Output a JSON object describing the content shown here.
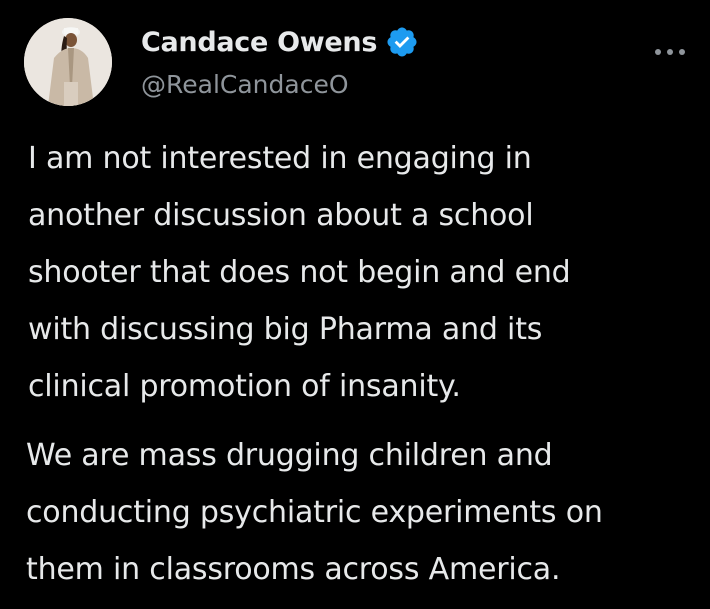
{
  "author": {
    "display_name": "Candace Owens",
    "handle": "@RealCandaceO",
    "verified_icon": "verified-check-icon",
    "avatar_icon": "avatar-photo"
  },
  "menu": {
    "icon": "more-horizontal-icon"
  },
  "tweet": {
    "paragraph1": [
      "I am not interested in engaging in",
      "another discussion about a school",
      "shooter that does not begin and end",
      "with discussing big Pharma and its",
      "clinical promotion of insanity."
    ],
    "paragraph2": [
      "We are mass drugging children and",
      "conducting psychiatric experiments on",
      "them in classrooms across America."
    ]
  },
  "colors": {
    "background": "#000000",
    "text": "#e7e9ea",
    "secondary_text": "#8f959b",
    "verified_blue": "#1d9bf0"
  }
}
